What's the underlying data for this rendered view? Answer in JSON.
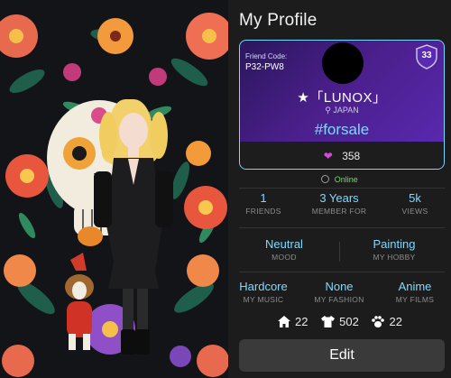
{
  "header": {
    "title": "My Profile"
  },
  "card": {
    "friend_code_label": "Friend Code:",
    "friend_code": "P32-PW8",
    "level": "33",
    "name": "★「LUNOX」",
    "country": "JAPAN",
    "tag": "#forsale",
    "likes": "358"
  },
  "status": {
    "text": "Online"
  },
  "stats": {
    "friends": {
      "value": "1",
      "label": "FRIENDS"
    },
    "member": {
      "value": "3 Years",
      "label": "MEMBER FOR"
    },
    "views": {
      "value": "5k",
      "label": "VIEWS"
    },
    "mood": {
      "value": "Neutral",
      "label": "MOOD"
    },
    "hobby": {
      "value": "Painting",
      "label": "MY HOBBY"
    },
    "music": {
      "value": "Hardcore",
      "label": "MY MUSIC"
    },
    "fashion": {
      "value": "None",
      "label": "MY FASHION"
    },
    "films": {
      "value": "Anime",
      "label": "MY FILMS"
    }
  },
  "counts": {
    "rooms": "22",
    "outfits": "502",
    "pets": "22"
  },
  "actions": {
    "edit": "Edit"
  },
  "colors": {
    "accent": "#7fd9ff",
    "online": "#74d86f",
    "heart": "#d44bd8",
    "card": "#4b1f8c"
  }
}
